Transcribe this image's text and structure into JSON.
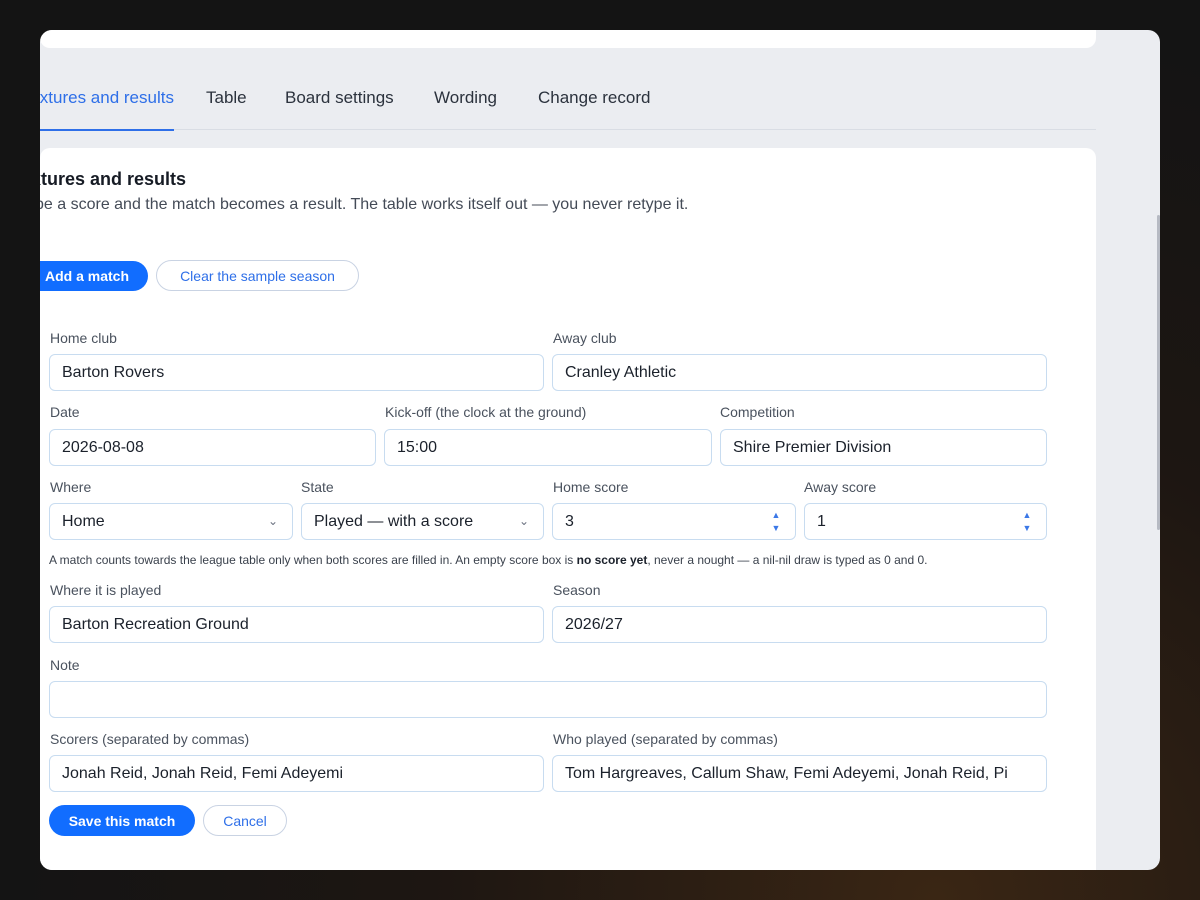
{
  "tabs": [
    {
      "label": "ixtures and results"
    },
    {
      "label": "Table"
    },
    {
      "label": "Board settings"
    },
    {
      "label": "Wording"
    },
    {
      "label": "Change record"
    }
  ],
  "panel": {
    "title": "ixtures and results",
    "subtitle": "ype a score and the match becomes a result. The table works itself out — you never retype it."
  },
  "actions": {
    "add_match": "Add a match",
    "clear_sample": "Clear the sample season"
  },
  "form": {
    "home_club": {
      "label": "Home club",
      "value": "Barton Rovers"
    },
    "away_club": {
      "label": "Away club",
      "value": "Cranley Athletic"
    },
    "date": {
      "label": "Date",
      "value": "2026-08-08"
    },
    "kickoff": {
      "label": "Kick-off (the clock at the ground)",
      "value": "15:00"
    },
    "competition": {
      "label": "Competition",
      "value": "Shire Premier Division"
    },
    "where": {
      "label": "Where",
      "value": "Home"
    },
    "state": {
      "label": "State",
      "value": "Played — with a score"
    },
    "home_score": {
      "label": "Home score",
      "value": "3"
    },
    "away_score": {
      "label": "Away score",
      "value": "1"
    },
    "hint_before": "A match counts towards the league table only when both scores are filled in. An empty score box is ",
    "hint_bold": "no score yet",
    "hint_after": ", never a nought — a nil-nil draw is typed as 0 and 0.",
    "venue": {
      "label": "Where it is played",
      "value": "Barton Recreation Ground"
    },
    "season": {
      "label": "Season",
      "value": "2026/27"
    },
    "note": {
      "label": "Note",
      "value": ""
    },
    "scorers": {
      "label": "Scorers (separated by commas)",
      "value": "Jonah Reid, Jonah Reid, Femi Adeyemi"
    },
    "players": {
      "label": "Who played (separated by commas)",
      "value": "Tom Hargreaves, Callum Shaw, Femi Adeyemi, Jonah Reid, Pi"
    },
    "save": "Save this match",
    "cancel": "Cancel"
  },
  "icons": {
    "select_chevron": "chevron-down-icon",
    "stepper": "up-down-stepper-icon"
  },
  "colors": {
    "accent": "#116dff",
    "active_tab": "#2e6fe8",
    "field_border": "#c8dcf0"
  }
}
